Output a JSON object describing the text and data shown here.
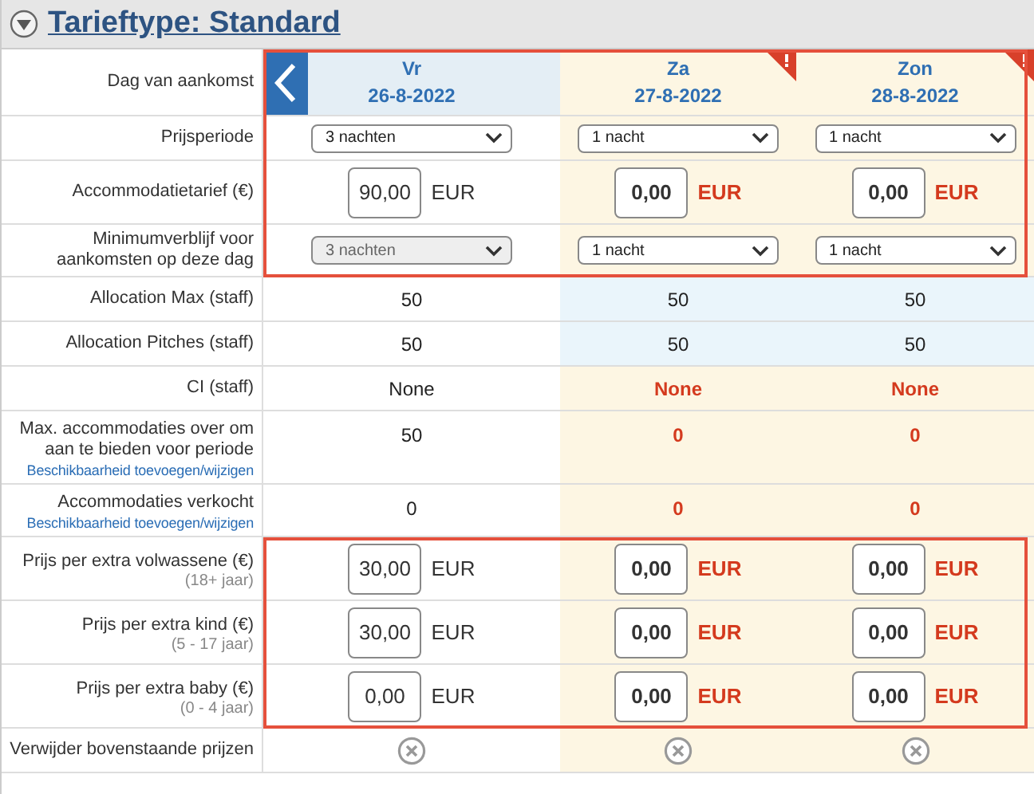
{
  "section": {
    "title": "Tarieftype: Standard",
    "expanded": true
  },
  "columns": [
    {
      "day": "Vr",
      "date": "26-8-2022",
      "flagged": false,
      "has_prev": true
    },
    {
      "day": "Za",
      "date": "27-8-2022",
      "flagged": true,
      "has_prev": false
    },
    {
      "day": "Zon",
      "date": "28-8-2022",
      "flagged": true,
      "has_prev": false
    }
  ],
  "groups": [
    {
      "outlined": true,
      "rows": [
        {
          "kind": "header",
          "label": "Dag van aankomst"
        },
        {
          "kind": "select",
          "label": "Prijsperiode",
          "cells": [
            {
              "value": "3 nachten",
              "disabled": false
            },
            {
              "value": "1 nacht",
              "disabled": false
            },
            {
              "value": "1 nacht",
              "disabled": false
            }
          ]
        },
        {
          "kind": "price",
          "label": "Accommodatietarief (€)",
          "cells": [
            {
              "value": "90,00",
              "unit": "EUR",
              "alert": false
            },
            {
              "value": "0,00",
              "unit": "EUR",
              "alert": true
            },
            {
              "value": "0,00",
              "unit": "EUR",
              "alert": true
            }
          ]
        },
        {
          "kind": "select",
          "label": "Minimumverblijf voor aankomsten op deze dag",
          "cells": [
            {
              "value": "3 nachten",
              "disabled": true
            },
            {
              "value": "1 nacht",
              "disabled": false
            },
            {
              "value": "1 nacht",
              "disabled": false
            }
          ]
        }
      ]
    },
    {
      "outlined": false,
      "rows": [
        {
          "kind": "text",
          "label": "Allocation Max (staff)",
          "staff": true,
          "cells": [
            {
              "value": "50",
              "alert": false
            },
            {
              "value": "50",
              "alert": false
            },
            {
              "value": "50",
              "alert": false
            }
          ]
        },
        {
          "kind": "text",
          "label": "Allocation Pitches (staff)",
          "staff": true,
          "cells": [
            {
              "value": "50",
              "alert": false
            },
            {
              "value": "50",
              "alert": false
            },
            {
              "value": "50",
              "alert": false
            }
          ]
        },
        {
          "kind": "text",
          "label": "CI (staff)",
          "staff": false,
          "cells": [
            {
              "value": "None",
              "alert": false
            },
            {
              "value": "None",
              "alert": true
            },
            {
              "value": "None",
              "alert": true
            }
          ]
        },
        {
          "kind": "text",
          "label": "Max. accommodaties over om aan te bieden voor periode",
          "link": "Beschikbaarheid toevoegen/wijzigen",
          "staff": false,
          "cells": [
            {
              "value": "50",
              "alert": false
            },
            {
              "value": "0",
              "alert": true
            },
            {
              "value": "0",
              "alert": true
            }
          ]
        },
        {
          "kind": "text",
          "label": "Accommodaties verkocht",
          "link": "Beschikbaarheid toevoegen/wijzigen",
          "staff": false,
          "cells": [
            {
              "value": "0",
              "alert": false
            },
            {
              "value": "0",
              "alert": true
            },
            {
              "value": "0",
              "alert": true
            }
          ]
        }
      ]
    },
    {
      "outlined": true,
      "rows": [
        {
          "kind": "price",
          "label": "Prijs per extra volwassene (€)",
          "note": "(18+ jaar)",
          "cells": [
            {
              "value": "30,00",
              "unit": "EUR",
              "alert": false
            },
            {
              "value": "0,00",
              "unit": "EUR",
              "alert": true
            },
            {
              "value": "0,00",
              "unit": "EUR",
              "alert": true
            }
          ]
        },
        {
          "kind": "price",
          "label": "Prijs per extra kind (€)",
          "note": "(5 - 17 jaar)",
          "cells": [
            {
              "value": "30,00",
              "unit": "EUR",
              "alert": false
            },
            {
              "value": "0,00",
              "unit": "EUR",
              "alert": true
            },
            {
              "value": "0,00",
              "unit": "EUR",
              "alert": true
            }
          ]
        },
        {
          "kind": "price",
          "label": "Prijs per extra baby (€)",
          "note": "(0 - 4 jaar)",
          "cells": [
            {
              "value": "0,00",
              "unit": "EUR",
              "alert": false
            },
            {
              "value": "0,00",
              "unit": "EUR",
              "alert": true
            },
            {
              "value": "0,00",
              "unit": "EUR",
              "alert": true
            }
          ]
        }
      ]
    },
    {
      "outlined": false,
      "rows": [
        {
          "kind": "remove",
          "label": "Verwijder bovenstaande prijzen"
        }
      ]
    }
  ]
}
